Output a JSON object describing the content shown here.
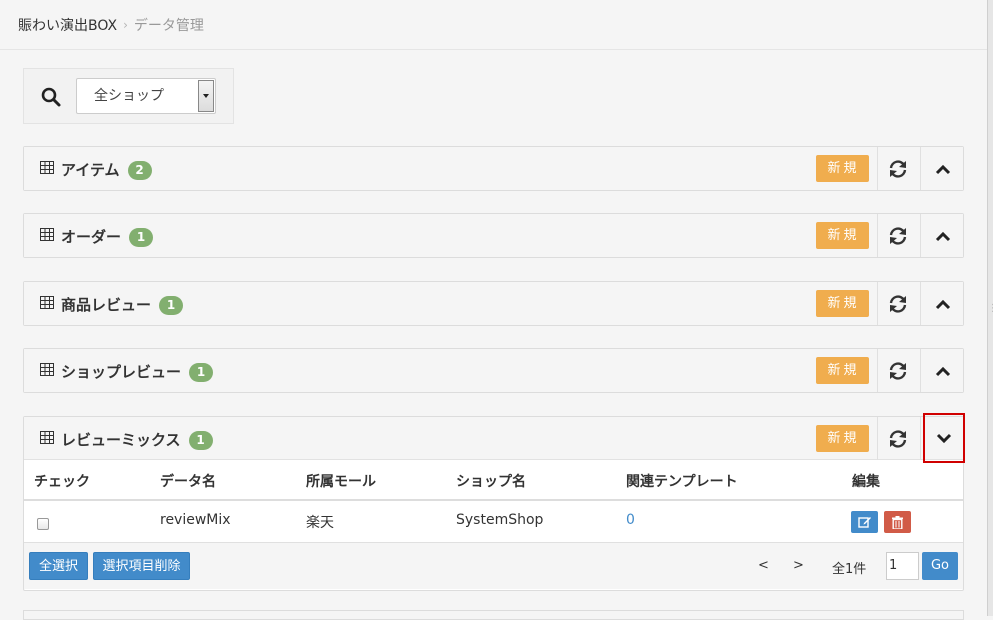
{
  "breadcrumb": {
    "home": "賑わい演出BOX",
    "separator": "›",
    "current": "データ管理"
  },
  "search": {
    "icon": "search-icon",
    "selected_shop": "全ショップ"
  },
  "panels": [
    {
      "title": "アイテム",
      "count": "2",
      "new_label": "新規",
      "state": "collapsed-up"
    },
    {
      "title": "オーダー",
      "count": "1",
      "new_label": "新規",
      "state": "collapsed-up"
    },
    {
      "title": "商品レビュー",
      "count": "1",
      "new_label": "新規",
      "state": "collapsed-up"
    },
    {
      "title": "ショップレビュー",
      "count": "1",
      "new_label": "新規",
      "state": "collapsed-up"
    },
    {
      "title": "レビューミックス",
      "count": "1",
      "new_label": "新規",
      "state": "expanded-down"
    }
  ],
  "table": {
    "columns": [
      "チェック",
      "データ名",
      "所属モール",
      "ショップ名",
      "関連テンプレート",
      "編集"
    ],
    "rows": [
      {
        "data_name": "reviewMix",
        "mall": "楽天",
        "shop": "SystemShop",
        "template": "0"
      }
    ]
  },
  "footer": {
    "select_all": "全選択",
    "delete_selected": "選択項目削除",
    "prev": "<",
    "next": ">",
    "total": "全1件",
    "page_value": "1",
    "go": "Go"
  },
  "colors": {
    "new_button": "#f0ad4e",
    "badge": "#82af6f",
    "primary": "#428bca",
    "danger": "#d15b47",
    "highlight_box": "#d00000"
  }
}
